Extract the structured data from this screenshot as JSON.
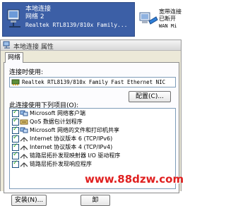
{
  "connection": {
    "title": "本地连接",
    "network": "网络  2",
    "adapter_short": "Realtek RTL8139/810x Family..."
  },
  "connection2": {
    "title": "宽带连接",
    "subtitle": "已断开",
    "type": "WAN Mi"
  },
  "dialog": {
    "title": "本地连接 属性",
    "tab_label": "网络",
    "connect_using_label": "连接时使用:",
    "adapter_name": "Realtek RTL8139/810x Family Fast Ethernet NIC",
    "configure_button": "配置(C)...",
    "items_label": "此连接使用下列项目(O):",
    "items": [
      {
        "label": "Microsoft 网络客户端",
        "checked": true,
        "icon": "network-client-icon"
      },
      {
        "label": "QoS 数据包计划程序",
        "checked": true,
        "icon": "qos-icon"
      },
      {
        "label": "Microsoft 网络的文件和打印机共享",
        "checked": true,
        "icon": "file-share-icon"
      },
      {
        "label": "Internet 协议版本 6 (TCP/IPv6)",
        "checked": true,
        "icon": "protocol-icon"
      },
      {
        "label": "Internet 协议版本 4 (TCP/IPv4)",
        "checked": true,
        "icon": "protocol-icon"
      },
      {
        "label": "链路层拓扑发现映射器 I/O 驱动程序",
        "checked": true,
        "icon": "protocol-icon"
      },
      {
        "label": "链路层拓扑发现响应程序",
        "checked": true,
        "icon": "protocol-icon"
      }
    ],
    "install_button": "安装(N)...",
    "uninstall_button": "卸"
  },
  "watermark": "www.88dzw.com"
}
